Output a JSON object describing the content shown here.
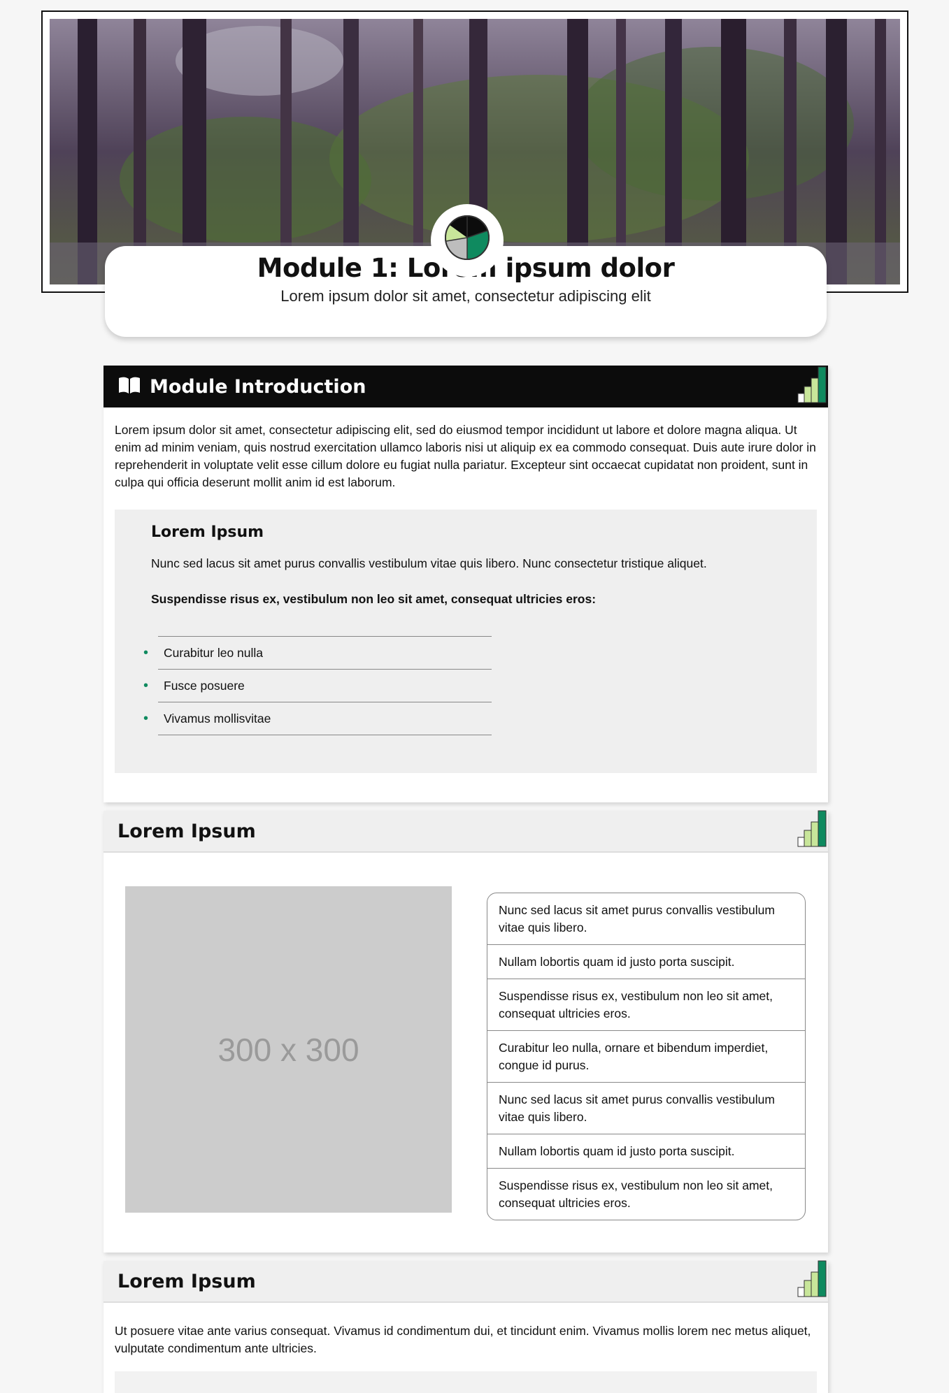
{
  "hero": {
    "title": "Module 1: Lorem ipsum dolor",
    "subtitle": "Lorem ipsum dolor sit amet, consectetur adipiscing elit"
  },
  "intro": {
    "heading": "Module Introduction",
    "paragraph": "Lorem ipsum dolor sit amet, consectetur adipiscing elit, sed do eiusmod tempor incididunt ut labore et dolore magna aliqua. Ut enim ad minim veniam, quis nostrud exercitation ullamco laboris nisi ut aliquip ex ea commodo consequat. Duis aute irure dolor in reprehenderit in voluptate velit esse cillum dolore eu fugiat nulla pariatur. Excepteur sint occaecat cupidatat non proident, sunt in culpa qui officia deserunt mollit anim id est laborum.",
    "callout": {
      "heading": "Lorem Ipsum",
      "text": "Nunc sed lacus sit amet purus convallis vestibulum vitae quis libero. Nunc consectetur tristique aliquet.",
      "bold_text": "Suspendisse risus ex, vestibulum non leo sit amet, consequat ultricies eros:",
      "items": [
        "Curabitur leo nulla",
        "Fusce posuere",
        "Vivamus mollisvitae"
      ]
    }
  },
  "section2": {
    "heading": "Lorem Ipsum",
    "placeholder": "300 x 300",
    "items": [
      "Nunc sed lacus sit amet purus convallis vestibulum vitae quis libero.",
      "Nullam lobortis quam id justo porta suscipit.",
      "Suspendisse risus ex, vestibulum non leo sit amet, consequat ultricies eros.",
      "Curabitur leo nulla, ornare et bibendum imperdiet, congue id purus.",
      "Nunc sed lacus sit amet purus convallis vestibulum vitae quis libero.",
      "Nullam lobortis quam id justo porta suscipit.",
      "Suspendisse risus ex, vestibulum non leo sit amet, consequat ultricies eros."
    ]
  },
  "section3": {
    "heading": "Lorem Ipsum",
    "paragraph": "Ut posuere vitae ante varius consequat. Vivamus id condimentum dui, et tincidunt enim. Vivamus mollis lorem nec metus aliquet, vulputate condimentum ante ultricies."
  },
  "icons": {
    "heading_icon": "book-icon",
    "level_icon": "signal-bars-icon",
    "logo": "pie-logo-icon"
  },
  "colors": {
    "accent_green": "#0f8a5f",
    "light_green": "#c8e69a",
    "header_dark": "#0c0c0c"
  }
}
